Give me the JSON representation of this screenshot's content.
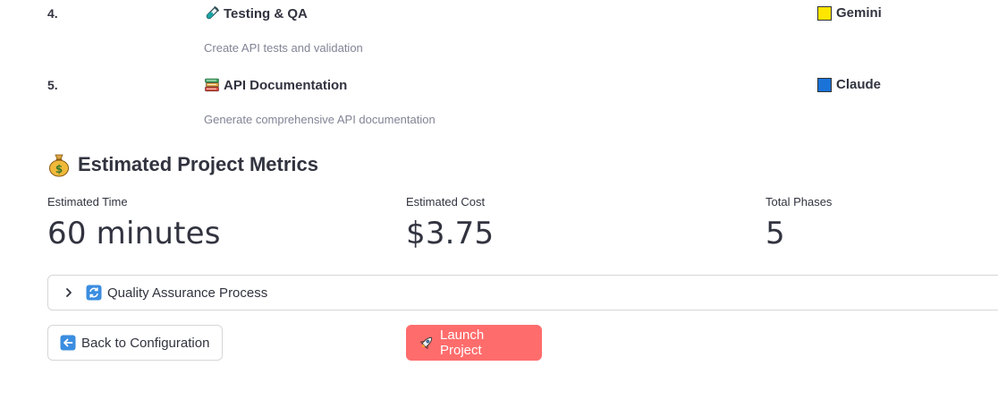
{
  "phases": [
    {
      "number": "4.",
      "icon": "test-tube-icon",
      "title": "Testing & QA",
      "description": "Create API tests and validation",
      "model": "Gemini",
      "model_color": "#ffe600"
    },
    {
      "number": "5.",
      "icon": "books-icon",
      "title": "API Documentation",
      "description": "Generate comprehensive API documentation",
      "model": "Claude",
      "model_color": "#1a73d9"
    }
  ],
  "metrics": {
    "icon": "money-bag-icon",
    "heading": "Estimated Project Metrics",
    "items": [
      {
        "label": "Estimated Time",
        "value": "60 minutes"
      },
      {
        "label": "Estimated Cost",
        "value": "$3.75"
      },
      {
        "label": "Total Phases",
        "value": "5"
      }
    ]
  },
  "expander": {
    "icon": "refresh-icon",
    "label": "Quality Assurance Process",
    "expanded": false
  },
  "buttons": {
    "back": {
      "icon": "left-arrow-icon",
      "label": "Back to Configuration"
    },
    "launch": {
      "icon": "rocket-icon",
      "label": "Launch Project"
    }
  },
  "colors": {
    "primary_button": "#ff6c6c",
    "text": "#31333f",
    "muted_text": "#808495"
  }
}
